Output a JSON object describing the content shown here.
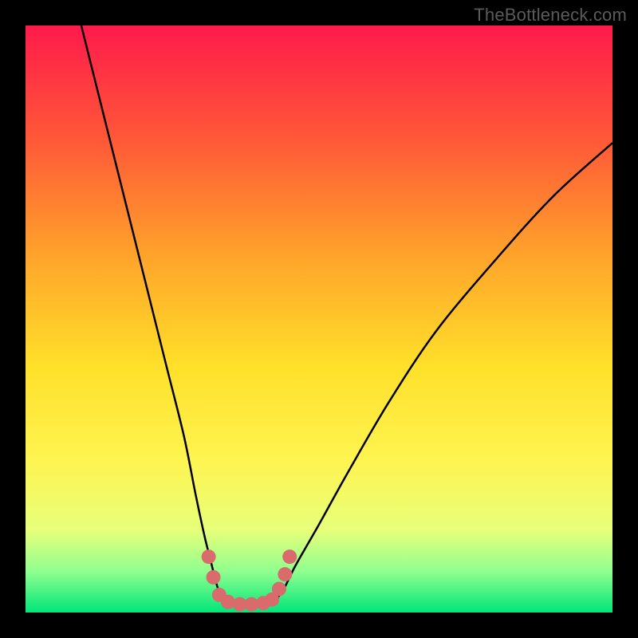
{
  "watermark": {
    "text": "TheBottleneck.com"
  },
  "colors": {
    "bg_black": "#000000",
    "curve": "#000000",
    "markers": "#d96b6c",
    "watermark": "#5b5b5b"
  },
  "gradient_stops": [
    {
      "offset": 0.0,
      "color": "#ff1a4b"
    },
    {
      "offset": 0.2,
      "color": "#ff5a37"
    },
    {
      "offset": 0.4,
      "color": "#ffa62a"
    },
    {
      "offset": 0.58,
      "color": "#ffe02a"
    },
    {
      "offset": 0.74,
      "color": "#fff450"
    },
    {
      "offset": 0.86,
      "color": "#e7ff7a"
    },
    {
      "offset": 0.93,
      "color": "#8fff8f"
    },
    {
      "offset": 1.0,
      "color": "#00e67a"
    }
  ],
  "chart_data": {
    "type": "line",
    "title": "",
    "xlabel": "",
    "ylabel": "",
    "xlim": [
      0,
      100
    ],
    "ylim": [
      0,
      100
    ],
    "series": [
      {
        "name": "left-branch",
        "x": [
          9.5,
          12,
          15,
          18,
          21,
          24,
          27,
          29,
          30.5,
          31.5,
          32.5,
          33.5
        ],
        "y": [
          100,
          90,
          78,
          66,
          54,
          42,
          30,
          20,
          13,
          9,
          5,
          2
        ]
      },
      {
        "name": "floor",
        "x": [
          33.5,
          35,
          37,
          39,
          41,
          42.5
        ],
        "y": [
          2,
          1.5,
          1.3,
          1.3,
          1.5,
          2
        ]
      },
      {
        "name": "right-branch",
        "x": [
          42.5,
          44,
          46,
          50,
          55,
          62,
          70,
          80,
          90,
          100
        ],
        "y": [
          2,
          4,
          8,
          15,
          24,
          36,
          48,
          60,
          71,
          80
        ]
      }
    ],
    "markers": {
      "name": "highlight-points",
      "color": "#d96b6c",
      "points": [
        {
          "x": 31.2,
          "y": 9.5
        },
        {
          "x": 32.0,
          "y": 6.0
        },
        {
          "x": 33.0,
          "y": 3.0
        },
        {
          "x": 34.5,
          "y": 1.8
        },
        {
          "x": 36.5,
          "y": 1.4
        },
        {
          "x": 38.5,
          "y": 1.4
        },
        {
          "x": 40.5,
          "y": 1.6
        },
        {
          "x": 42.0,
          "y": 2.2
        },
        {
          "x": 43.2,
          "y": 4.0
        },
        {
          "x": 44.2,
          "y": 6.5
        },
        {
          "x": 45.0,
          "y": 9.5
        }
      ]
    }
  }
}
